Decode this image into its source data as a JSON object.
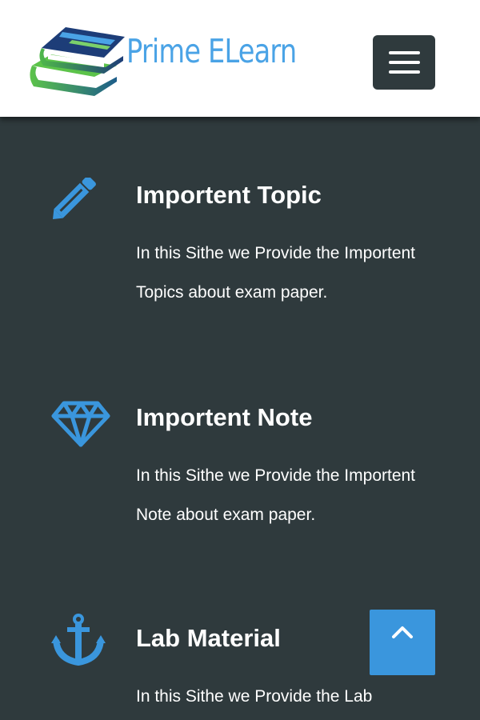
{
  "header": {
    "brand_name": "Prime ELearn",
    "menu_icon": "hamburger-menu-icon"
  },
  "features": [
    {
      "icon": "pencil-icon",
      "title": "Importent Topic",
      "description": "In this Sithe we Provide the Importent Topics about exam paper."
    },
    {
      "icon": "diamond-icon",
      "title": "Importent Note",
      "description": "In this Sithe we Provide the Importent Note about exam paper."
    },
    {
      "icon": "anchor-icon",
      "title": "Lab Material",
      "description": "In this Sithe we Provide the Lab"
    }
  ],
  "scroll_top": {
    "icon": "chevron-up-icon"
  },
  "colors": {
    "accent": "#3a96dd",
    "background": "#2f3a3d",
    "header_bg": "#ffffff",
    "brand_text": "#4aa3e6",
    "logo_green": "#5cc34a",
    "logo_navy": "#1d3d78"
  }
}
